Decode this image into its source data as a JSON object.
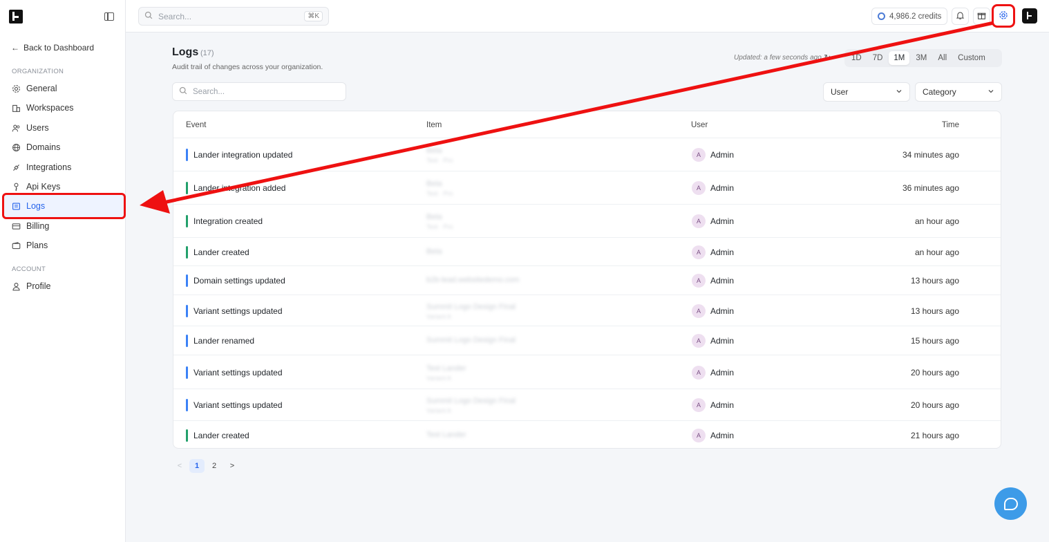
{
  "sidebar": {
    "back_label": "Back to Dashboard",
    "org_section": "ORGANIZATION",
    "account_section": "ACCOUNT",
    "items": [
      {
        "label": "General",
        "icon": "gear-icon"
      },
      {
        "label": "Workspaces",
        "icon": "building-icon"
      },
      {
        "label": "Users",
        "icon": "users-icon"
      },
      {
        "label": "Domains",
        "icon": "globe-icon"
      },
      {
        "label": "Integrations",
        "icon": "plug-icon"
      },
      {
        "label": "Api Keys",
        "icon": "key-icon"
      },
      {
        "label": "Logs",
        "icon": "list-icon",
        "active": true
      },
      {
        "label": "Billing",
        "icon": "credit-card-icon"
      },
      {
        "label": "Plans",
        "icon": "wallet-icon"
      }
    ],
    "account_items": [
      {
        "label": "Profile",
        "icon": "user-icon"
      }
    ]
  },
  "topbar": {
    "search_placeholder": "Search...",
    "shortcut": "⌘K",
    "credits": "4,986.2 credits"
  },
  "page": {
    "title": "Logs",
    "count": "(17)",
    "subtitle": "Audit trail of changes across your organization.",
    "updated": "Updated: a few seconds ago",
    "ranges": [
      "1D",
      "7D",
      "1M",
      "3M",
      "All",
      "Custom"
    ],
    "active_range": "1M",
    "search_placeholder": "Search...",
    "user_filter": "User",
    "category_filter": "Category"
  },
  "table": {
    "headers": {
      "event": "Event",
      "item": "Item",
      "user": "User",
      "time": "Time"
    },
    "rows": [
      {
        "event": "Lander integration updated",
        "item": "Beta",
        "item_sub": "Test · Pro",
        "user": "Admin",
        "avatar": "A",
        "time": "34 minutes ago",
        "color": "#3b82f6"
      },
      {
        "event": "Lander integration added",
        "item": "Beta",
        "item_sub": "Test · Pro",
        "user": "Admin",
        "avatar": "A",
        "time": "36 minutes ago",
        "color": "#22a06b"
      },
      {
        "event": "Integration created",
        "item": "Beta",
        "item_sub": "Test · Pro",
        "user": "Admin",
        "avatar": "A",
        "time": "an hour ago",
        "color": "#22a06b"
      },
      {
        "event": "Lander created",
        "item": "Beta",
        "item_sub": "",
        "user": "Admin",
        "avatar": "A",
        "time": "an hour ago",
        "color": "#22a06b"
      },
      {
        "event": "Domain settings updated",
        "item": "b2b-lead.websitedemo.com",
        "item_sub": "",
        "user": "Admin",
        "avatar": "A",
        "time": "13 hours ago",
        "color": "#3b82f6"
      },
      {
        "event": "Variant settings updated",
        "item": "Summit Logo Design Final",
        "item_sub": "Variant A",
        "user": "Admin",
        "avatar": "A",
        "time": "13 hours ago",
        "color": "#3b82f6"
      },
      {
        "event": "Lander renamed",
        "item": "Summit Logo Design Final",
        "item_sub": "",
        "user": "Admin",
        "avatar": "A",
        "time": "15 hours ago",
        "color": "#3b82f6"
      },
      {
        "event": "Variant settings updated",
        "item": "Test Lander",
        "item_sub": "Variant A",
        "user": "Admin",
        "avatar": "A",
        "time": "20 hours ago",
        "color": "#3b82f6"
      },
      {
        "event": "Variant settings updated",
        "item": "Summit Logo Design Final",
        "item_sub": "Variant A",
        "user": "Admin",
        "avatar": "A",
        "time": "20 hours ago",
        "color": "#3b82f6"
      },
      {
        "event": "Lander created",
        "item": "Test Lander",
        "item_sub": "",
        "user": "Admin",
        "avatar": "A",
        "time": "21 hours ago",
        "color": "#22a06b"
      }
    ]
  },
  "pagination": {
    "prev": "<",
    "pages": [
      "1",
      "2"
    ],
    "next": ">",
    "current": "1"
  },
  "colors": {
    "accent": "#2563eb",
    "highlight": "#e11111",
    "help": "#3d9be8"
  }
}
